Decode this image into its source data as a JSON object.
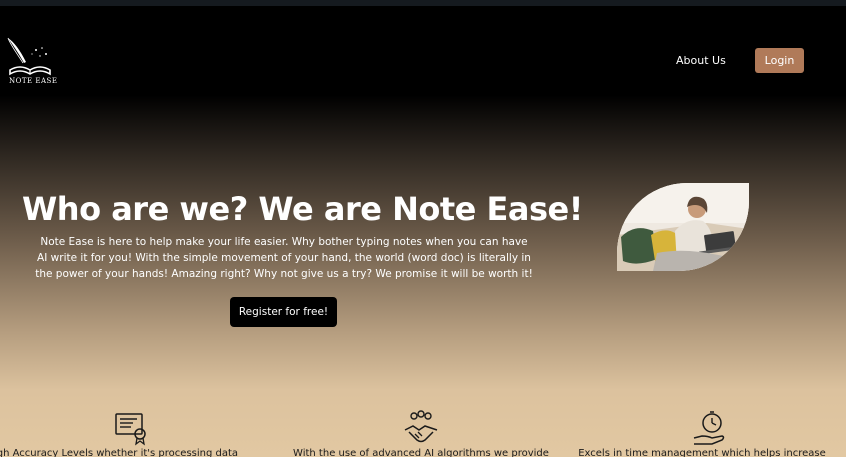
{
  "header": {
    "logo_text": "NOTE EASE",
    "nav": {
      "about": "About Us",
      "login": "Login"
    }
  },
  "hero": {
    "title": "Who are we? We are Note Ease!",
    "description": "Note Ease is here to help make your life easier. Why bother typing notes when you can have AI write it for you! With the simple movement of your hand, the world (word doc) is literally in the power of your hands! Amazing right? Why not give us a try? We promise it will be worth it!",
    "cta": "Register for free!"
  },
  "features": [
    {
      "icon": "certificate-icon",
      "text": "igh Accuracy Levels whether it's processing data"
    },
    {
      "icon": "handshake-icon",
      "text": "With the use of advanced AI algorithms we provide"
    },
    {
      "icon": "stopwatch-hand-icon",
      "text": "Excels in time management which helps increase"
    }
  ],
  "colors": {
    "login_button": "#b07a59",
    "register_button": "#000000",
    "bg_top": "#000000",
    "bg_bottom": "#e2c8a2"
  }
}
